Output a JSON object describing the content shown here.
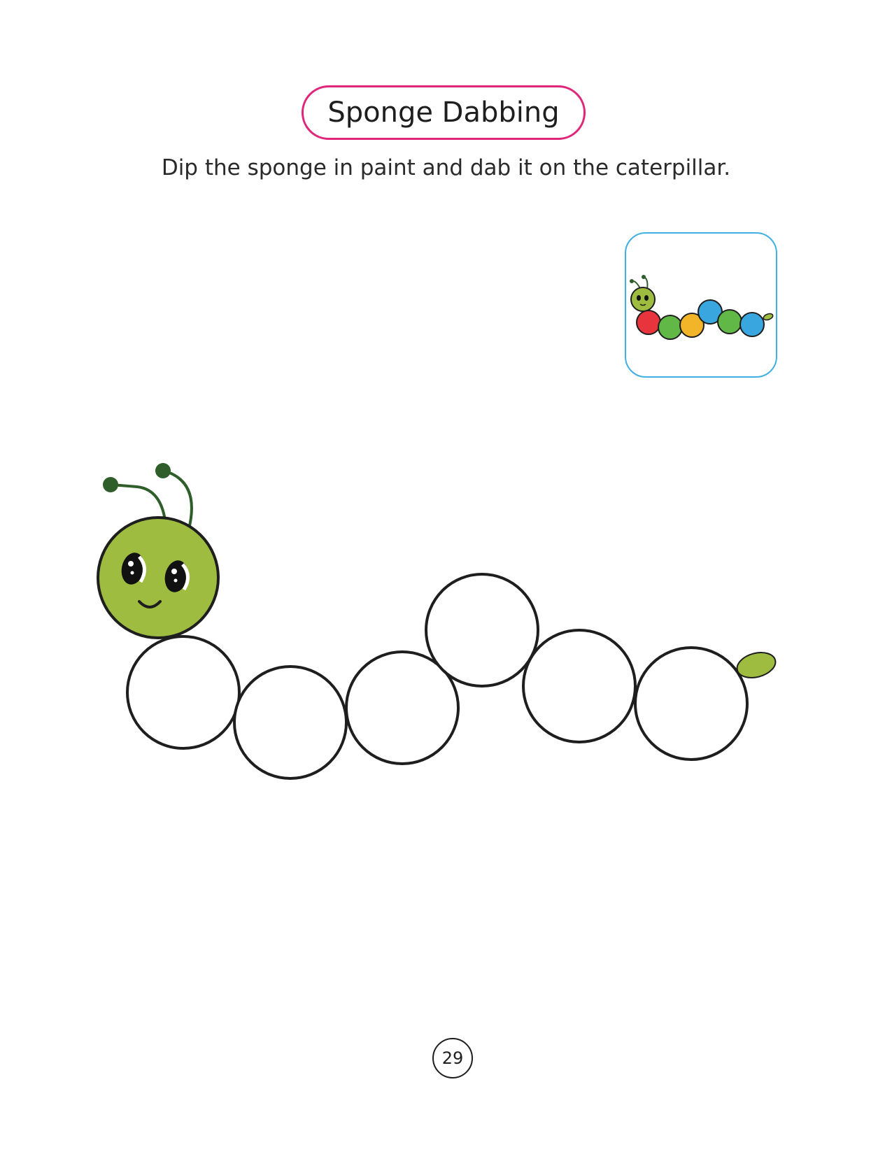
{
  "header": {
    "title": "Sponge Dabbing"
  },
  "instruction": "Dip the sponge in paint and dab it on the caterpillar.",
  "example": {
    "segment_colors": [
      "#e8343c",
      "#62b846",
      "#f2b52a",
      "#3aa6e0",
      "#62b846",
      "#3aa6e0"
    ]
  },
  "colors": {
    "title_border": "#e0267a",
    "example_border": "#3fb0e0",
    "head_fill": "#9ebd40",
    "antenna": "#2f5e2a",
    "tail_fill": "#9ebd40",
    "outline": "#1e1e1e"
  },
  "footer": {
    "page_number": "29"
  }
}
